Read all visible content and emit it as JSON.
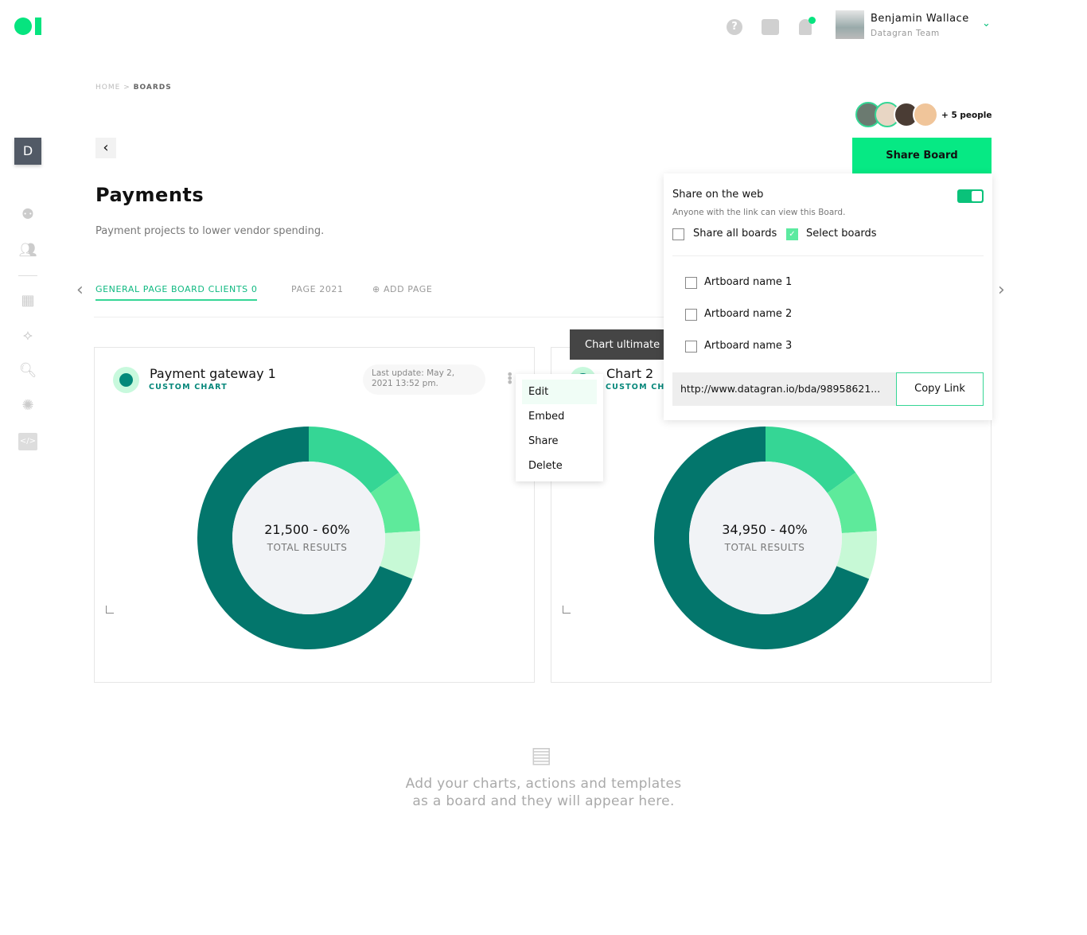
{
  "header": {
    "user_name": "Benjamin Wallace",
    "user_team": "Datagran Team",
    "icons": [
      "help-icon",
      "graduation-cap-icon",
      "bell-icon"
    ]
  },
  "breadcrumb": {
    "home": "HOME",
    "sep": ">",
    "current": "BOARDS"
  },
  "sidebar": {
    "workspace_initial": "D",
    "items": [
      "pipeline-icon",
      "team-icon",
      "dashboard-icon",
      "network-icon",
      "analytics-search-icon",
      "brain-icon",
      "code-icon"
    ]
  },
  "page": {
    "title": "Payments",
    "subtitle": "Payment projects to lower vendor spending."
  },
  "tabs": [
    {
      "label": "GENERAL PAGE BOARD CLIENTS 0",
      "active": true
    },
    {
      "label": "PAGE 2021"
    },
    {
      "label": "ADD PAGE"
    }
  ],
  "collaborators": {
    "count_label": "+ 5 people"
  },
  "share_button": "Share Board",
  "share_panel": {
    "title": "Share on the web",
    "toggle_on": true,
    "description": "Anyone with the link can view this Board.",
    "share_all": "Share all boards",
    "share_all_checked": false,
    "select_boards": "Select boards",
    "select_boards_checked": true,
    "artboards": [
      {
        "name": "Artboard name 1",
        "checked": false
      },
      {
        "name": "Artboard name 2",
        "checked": false
      },
      {
        "name": "Artboard name 3",
        "checked": false
      }
    ],
    "link": "http://www.datagran.io/bda/98958621...",
    "copy_label": "Copy Link"
  },
  "cards": [
    {
      "title": "Payment gateway 1",
      "subtitle": "CUSTOM CHART",
      "last_update": "Last update: May 2, 2021 13:52 pm.",
      "center_value": "21,500 - 60%",
      "center_label": "TOTAL RESULTS"
    },
    {
      "title": "Chart 2",
      "subtitle": "CUSTOM CHART",
      "tooltip": "Chart ultimate c",
      "center_value": "34,950 - 40%",
      "center_label": "TOTAL RESULTS"
    }
  ],
  "context_menu": [
    "Edit",
    "Embed",
    "Share",
    "Delete"
  ],
  "empty_state": {
    "line1": "Add your charts, actions and templates",
    "line2": "as a board and they will appear here."
  },
  "chart_data": [
    {
      "type": "pie",
      "values": [
        15,
        9,
        7,
        69
      ],
      "colors": [
        "#35d695",
        "#5eea9b",
        "#c7f9d6",
        "#03766c"
      ]
    },
    {
      "type": "pie",
      "values": [
        15,
        9,
        7,
        69
      ],
      "colors": [
        "#35d695",
        "#5eea9b",
        "#c7f9d6",
        "#03766c"
      ]
    }
  ],
  "colors": {
    "accent": "#06e984",
    "dark_teal": "#03766c"
  }
}
